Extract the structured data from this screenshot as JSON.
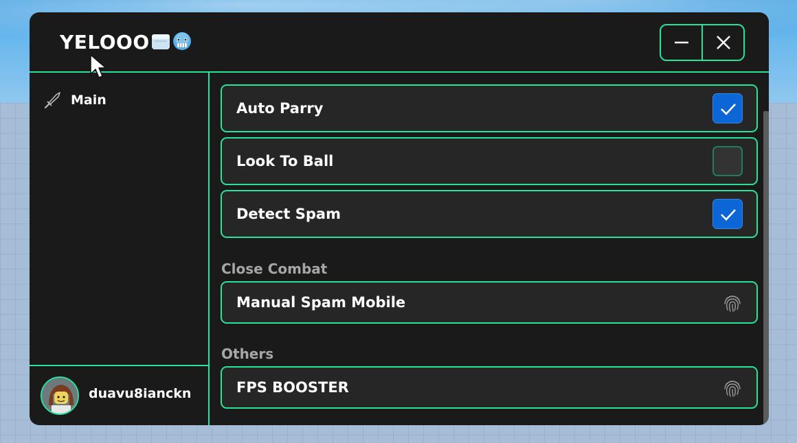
{
  "window": {
    "title": "YELOOO",
    "title_emojis": [
      "ice-cube-icon",
      "cold-face-icon"
    ],
    "controls": [
      "minimize-icon",
      "close-icon"
    ]
  },
  "sidebar": {
    "items": [
      {
        "label": "Main",
        "icon": "sword-icon"
      }
    ],
    "profile": {
      "username": "duavu8ianckn"
    }
  },
  "main": {
    "toggles": [
      {
        "label": "Auto Parry",
        "checked": true
      },
      {
        "label": "Look To Ball",
        "checked": false
      },
      {
        "label": "Detect Spam",
        "checked": true
      }
    ],
    "sections": [
      {
        "title": "Close Combat",
        "buttons": [
          {
            "label": "Manual Spam Mobile",
            "icon": "fingerprint-icon"
          }
        ]
      },
      {
        "title": "Others",
        "buttons": [
          {
            "label": "FPS BOOSTER",
            "icon": "fingerprint-icon"
          }
        ]
      }
    ]
  },
  "colors": {
    "accent": "#28e39a",
    "panel": "#1a1a1a",
    "row": "#262626",
    "checkbox_on": "#0c66d6",
    "section_text": "#a6a6a6"
  }
}
